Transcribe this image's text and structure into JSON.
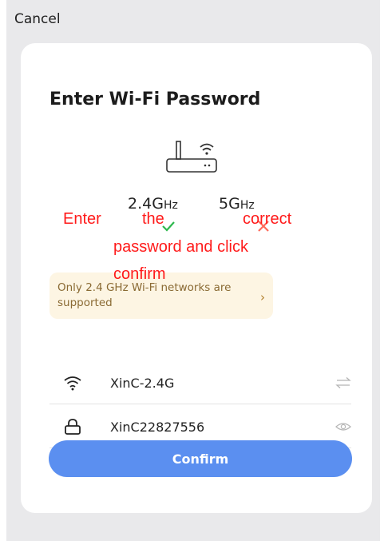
{
  "header": {
    "cancel_label": "Cancel"
  },
  "card": {
    "title": "Enter Wi-Fi Password",
    "bands": [
      {
        "value": "2.4",
        "unit": "G",
        "suffix": "Hz",
        "status": "check-icon"
      },
      {
        "value": "5",
        "unit": "G",
        "suffix": "Hz",
        "status": "cross-icon"
      }
    ],
    "tip": {
      "text": "Only 2.4 GHz Wi-Fi networks are supported",
      "chevron": "›"
    },
    "network": {
      "ssid": "XinC-2.4G",
      "icon": "wifi-icon",
      "action_icon": "switch-network-icon"
    },
    "password": {
      "value": "XinC22827556",
      "icon": "lock-icon",
      "action_icon": "eye-icon"
    },
    "confirm_label": "Confirm"
  },
  "overlay_instruction": {
    "words": [
      "Enter",
      "the",
      "correct",
      "password and  click",
      "confirm"
    ],
    "color": "#ff1a1a"
  },
  "colors": {
    "accent": "#5b8ff0",
    "success": "#2db84d",
    "error": "#ff6a5a",
    "tip_bg": "#fdf5e3",
    "tip_text": "#8a6a33"
  }
}
